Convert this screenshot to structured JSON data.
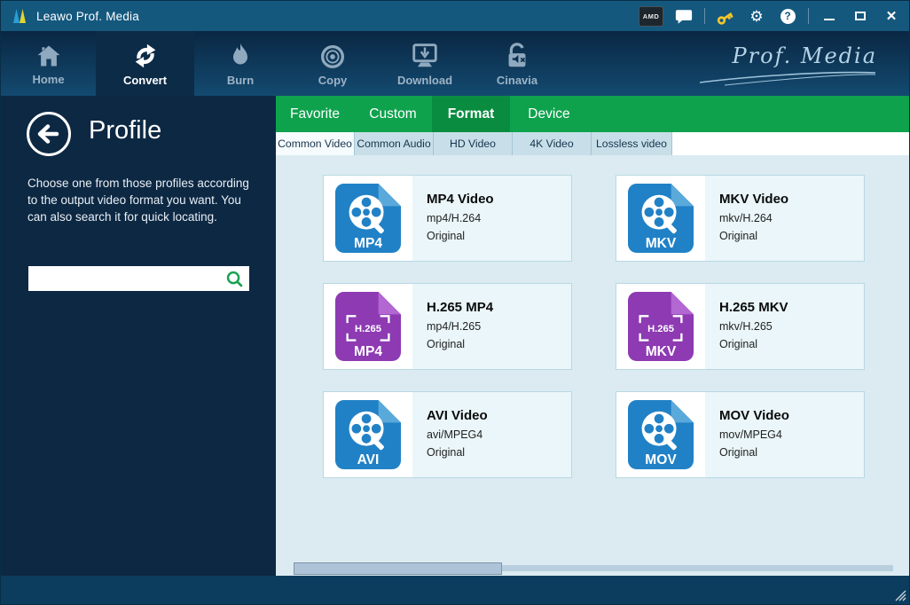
{
  "window": {
    "title": "Leawo Prof. Media"
  },
  "titlebar": {
    "amd_badge": "AMD",
    "gear_glyph": "⚙",
    "help_glyph": "?",
    "close_glyph": "✕"
  },
  "nav": {
    "brand": "Prof. Media",
    "items": [
      {
        "label": "Home",
        "active": false
      },
      {
        "label": "Convert",
        "active": true
      },
      {
        "label": "Burn",
        "active": false
      },
      {
        "label": "Copy",
        "active": false
      },
      {
        "label": "Download",
        "active": false
      },
      {
        "label": "Cinavia",
        "active": false
      }
    ]
  },
  "sidebar": {
    "title": "Profile",
    "description": "Choose one from those profiles according to the output video format you want. You can also search it for quick locating.",
    "search": {
      "value": "",
      "placeholder": ""
    }
  },
  "format_tabs": {
    "items": [
      "Favorite",
      "Custom",
      "Format",
      "Device"
    ],
    "active": "Format"
  },
  "sub_tabs": {
    "items": [
      "Common Video",
      "Common Audio",
      "HD Video",
      "4K Video",
      "Lossless video"
    ],
    "active": "Common Video"
  },
  "profiles": [
    {
      "title": "MP4 Video",
      "format": "mp4/H.264",
      "quality": "Original",
      "badge": "MP4",
      "icon": "film-reel",
      "icon_color": "#2181c6"
    },
    {
      "title": "MKV Video",
      "format": "mkv/H.264",
      "quality": "Original",
      "badge": "MKV",
      "icon": "film-reel",
      "icon_color": "#2181c6"
    },
    {
      "title": "H.265 MP4",
      "format": "mp4/H.265",
      "quality": "Original",
      "badge": "MP4",
      "badge_top": "H.265",
      "icon": "h265",
      "icon_color": "#8d3ab3"
    },
    {
      "title": "H.265 MKV",
      "format": "mkv/H.265",
      "quality": "Original",
      "badge": "MKV",
      "badge_top": "H.265",
      "icon": "h265",
      "icon_color": "#8d3ab3"
    },
    {
      "title": "AVI Video",
      "format": "avi/MPEG4",
      "quality": "Original",
      "badge": "AVI",
      "icon": "film-reel",
      "icon_color": "#2181c6"
    },
    {
      "title": "MOV Video",
      "format": "mov/MPEG4",
      "quality": "Original",
      "badge": "MOV",
      "icon": "film-reel",
      "icon_color": "#2181c6"
    }
  ],
  "colors": {
    "titlebar": "#14587e",
    "nav_top": "#0a2743",
    "nav_bottom": "#134a70",
    "nav_active": "#0c2b47",
    "sidebar": "#0d2843",
    "accent_green": "#0fa24d",
    "active_green": "#0a8c40",
    "content_bg": "#dbebf1",
    "footer": "#0c3d5e",
    "key_yellow": "#f4c52a",
    "search_green": "#1aa053"
  }
}
